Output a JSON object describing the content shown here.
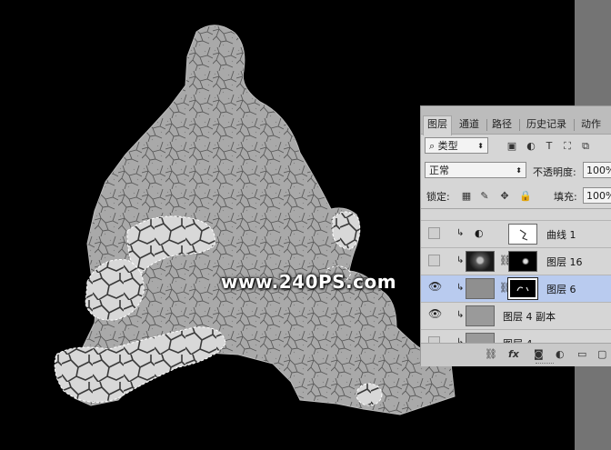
{
  "watermark": "www.240PS.com",
  "panel": {
    "tabs": [
      "图层",
      "通道",
      "路径",
      "历史记录",
      "动作"
    ],
    "filter_label": "类型",
    "blend_mode": "正常",
    "opacity_label": "不透明度:",
    "opacity_value": "100%",
    "lock_label": "锁定:",
    "fill_label": "填充:",
    "fill_value": "100%",
    "layers": [
      {
        "name": "曲线 1",
        "visible": false,
        "selected": false
      },
      {
        "name": "图层 16",
        "visible": false,
        "selected": false
      },
      {
        "name": "图层 6",
        "visible": true,
        "selected": true
      },
      {
        "name": "图层 4 副本",
        "visible": true,
        "selected": false
      },
      {
        "name": "图层 4",
        "visible": false,
        "selected": false
      }
    ],
    "bottom_icons": [
      "link-icon",
      "fx-icon",
      "mask-icon",
      "adjustment-icon",
      "folder-icon",
      "new-layer-icon",
      "trash-icon"
    ]
  },
  "colors": {
    "background": "#000000",
    "panel": "#d6d6d6",
    "selected_layer": "#b9cbef"
  }
}
